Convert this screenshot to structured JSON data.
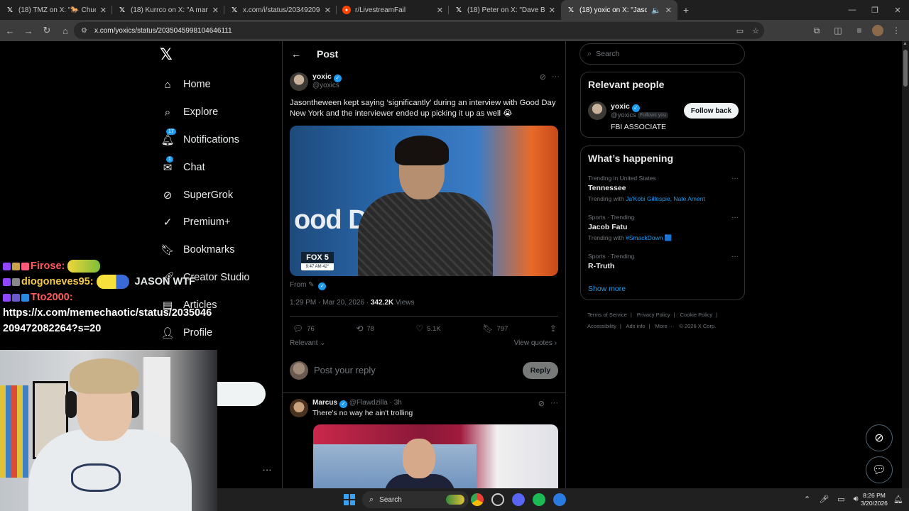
{
  "browser": {
    "tabs": [
      {
        "title": "(18) TMZ on X: \"🐎 Chuck Norris",
        "icon": "x-logo-icon"
      },
      {
        "title": "(18) Kurrco on X: \"A man has pl",
        "icon": "x-logo-icon"
      },
      {
        "title": "x.com/i/status/2034920947296",
        "icon": "x-logo-icon"
      },
      {
        "title": "r/LivestreamFail",
        "icon": "reddit-icon"
      },
      {
        "title": "(18) Peter on X: \"Dave Bautista",
        "icon": "x-logo-icon"
      },
      {
        "title": "(18) yoxic on X: \"Jasonthewe",
        "icon": "x-logo-icon",
        "active": true
      }
    ],
    "url": "x.com/yoxics/status/2035045998104646111"
  },
  "nav": {
    "items": [
      {
        "label": "Home",
        "icon": "home-icon"
      },
      {
        "label": "Explore",
        "icon": "search-icon"
      },
      {
        "label": "Notifications",
        "icon": "bell-icon",
        "badge": "17"
      },
      {
        "label": "Chat",
        "icon": "envelope-icon",
        "badge": "1"
      },
      {
        "label": "SuperGrok",
        "icon": "grok-icon"
      },
      {
        "label": "Premium+",
        "icon": "premium-icon"
      },
      {
        "label": "Bookmarks",
        "icon": "bookmark-icon"
      },
      {
        "label": "Creator Studio",
        "icon": "rocket-icon"
      },
      {
        "label": "Articles",
        "icon": "article-icon"
      },
      {
        "label": "Profile",
        "icon": "person-icon"
      }
    ],
    "more": "..."
  },
  "main": {
    "header_title": "Post",
    "post": {
      "author": "yoxic",
      "handle": "@yoxics",
      "text": "Jasontheween kept saying ‘significantly’ during an interview with Good Day New York and the interviewer ended up picking it up as well 😭",
      "media": {
        "studio_text": "ood D     w",
        "channel": "FOX 5",
        "time": "9:47 AM  42°"
      },
      "from": "From",
      "time": "1:29 PM · Mar 20, 2026 · ",
      "views_count": "342.2K",
      "views_label": " Views",
      "replies": "76",
      "reposts": "78",
      "likes": "5.1K",
      "bookmarks": "797",
      "sort": "Relevant",
      "view_quotes": "View quotes"
    },
    "reply_placeholder": "Post your reply",
    "reply_button": "Reply",
    "top_reply": {
      "author": "Marcus",
      "handle": "@Flawdzilla",
      "time": "3h",
      "text": "There's no way he ain't trolling"
    }
  },
  "right": {
    "search_placeholder": "Search",
    "relevant": {
      "title": "Relevant people",
      "name": "yoxic",
      "handle": "@yoxics",
      "follows_you": "Follows you",
      "bio": "FBI ASSOCIATE",
      "button": "Follow back"
    },
    "happening": {
      "title": "What’s happening",
      "trends": [
        {
          "context": "Trending in United States",
          "name": "Tennessee",
          "with_label": "Trending with ",
          "with": "Ja'Kobi Gillespie, Nate Ament"
        },
        {
          "context": "Sports · Trending",
          "name": "Jacob Fatu",
          "with_label": "Trending with ",
          "with": "#SmackDown 🟦"
        },
        {
          "context": "Sports · Trending",
          "name": "R-Truth",
          "with_label": "",
          "with": ""
        }
      ],
      "show_more": "Show more"
    },
    "footer": [
      "Terms of Service",
      "|",
      "Privacy Policy",
      "|",
      "Cookie Policy",
      "|",
      "Accessibility",
      "|",
      "Ads info",
      "|",
      "More ···",
      "© 2026 X Corp."
    ]
  },
  "stream_chat": [
    {
      "user": "Firose:",
      "user_color": "#ff5a5a",
      "message": ""
    },
    {
      "user": "diogoneves95:",
      "user_color": "#f5c84a",
      "message": "JASON WTF"
    },
    {
      "user": "Tto2000:",
      "user_color": "#ff5a5a",
      "message": ""
    }
  ],
  "stream_chat_url": "https://x.com/memechaotic/status/2035046209472082264?s=20",
  "taskbar": {
    "search": "Search",
    "time": "8:26 PM",
    "date": "3/20/2026"
  },
  "colors": {
    "accent": "#1d9bf0",
    "background": "#000000",
    "border": "#2f3336",
    "muted": "#71767b"
  }
}
